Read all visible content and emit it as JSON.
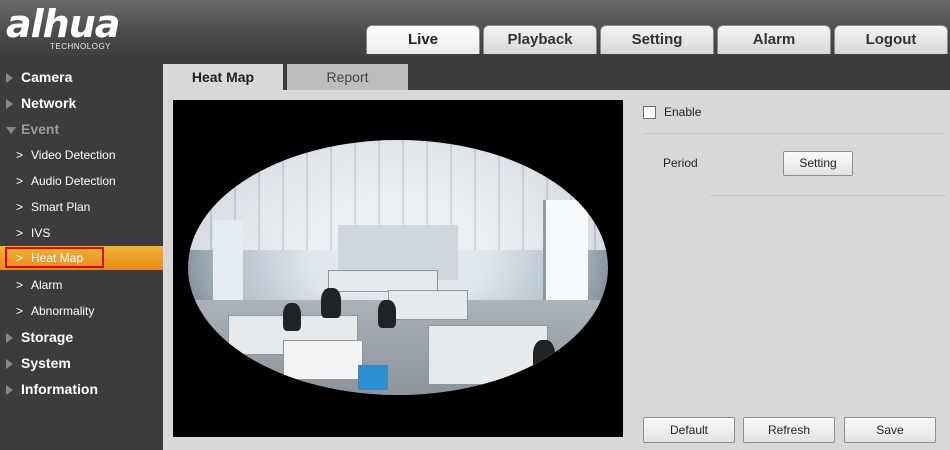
{
  "brand": {
    "name": "alhua",
    "tagline": "TECHNOLOGY"
  },
  "nav": {
    "tabs": [
      {
        "label": "Live"
      },
      {
        "label": "Playback"
      },
      {
        "label": "Setting"
      },
      {
        "label": "Alarm"
      },
      {
        "label": "Logout"
      }
    ],
    "active": "Live"
  },
  "sidebar": {
    "items": [
      {
        "label": "Camera",
        "type": "group"
      },
      {
        "label": "Network",
        "type": "group"
      },
      {
        "label": "Event",
        "type": "group",
        "expanded": true
      },
      {
        "label": "Video Detection",
        "type": "sub"
      },
      {
        "label": "Audio Detection",
        "type": "sub"
      },
      {
        "label": "Smart Plan",
        "type": "sub"
      },
      {
        "label": "IVS",
        "type": "sub"
      },
      {
        "label": "Heat Map",
        "type": "sub",
        "selected": true
      },
      {
        "label": "Alarm",
        "type": "sub"
      },
      {
        "label": "Abnormality",
        "type": "sub"
      },
      {
        "label": "Storage",
        "type": "group"
      },
      {
        "label": "System",
        "type": "group"
      },
      {
        "label": "Information",
        "type": "group"
      }
    ]
  },
  "content_tabs": [
    {
      "label": "Heat Map",
      "active": true
    },
    {
      "label": "Report",
      "active": false
    }
  ],
  "form": {
    "enable_label": "Enable",
    "enable_checked": false,
    "period_label": "Period",
    "period_button": "Setting"
  },
  "actions": {
    "default_label": "Default",
    "refresh_label": "Refresh",
    "save_label": "Save"
  },
  "colors": {
    "accent": "#ef9a28",
    "selection_outline": "#e00000",
    "sidebar_bg": "#3c3c3c",
    "panel_bg": "#d8d8d8"
  }
}
